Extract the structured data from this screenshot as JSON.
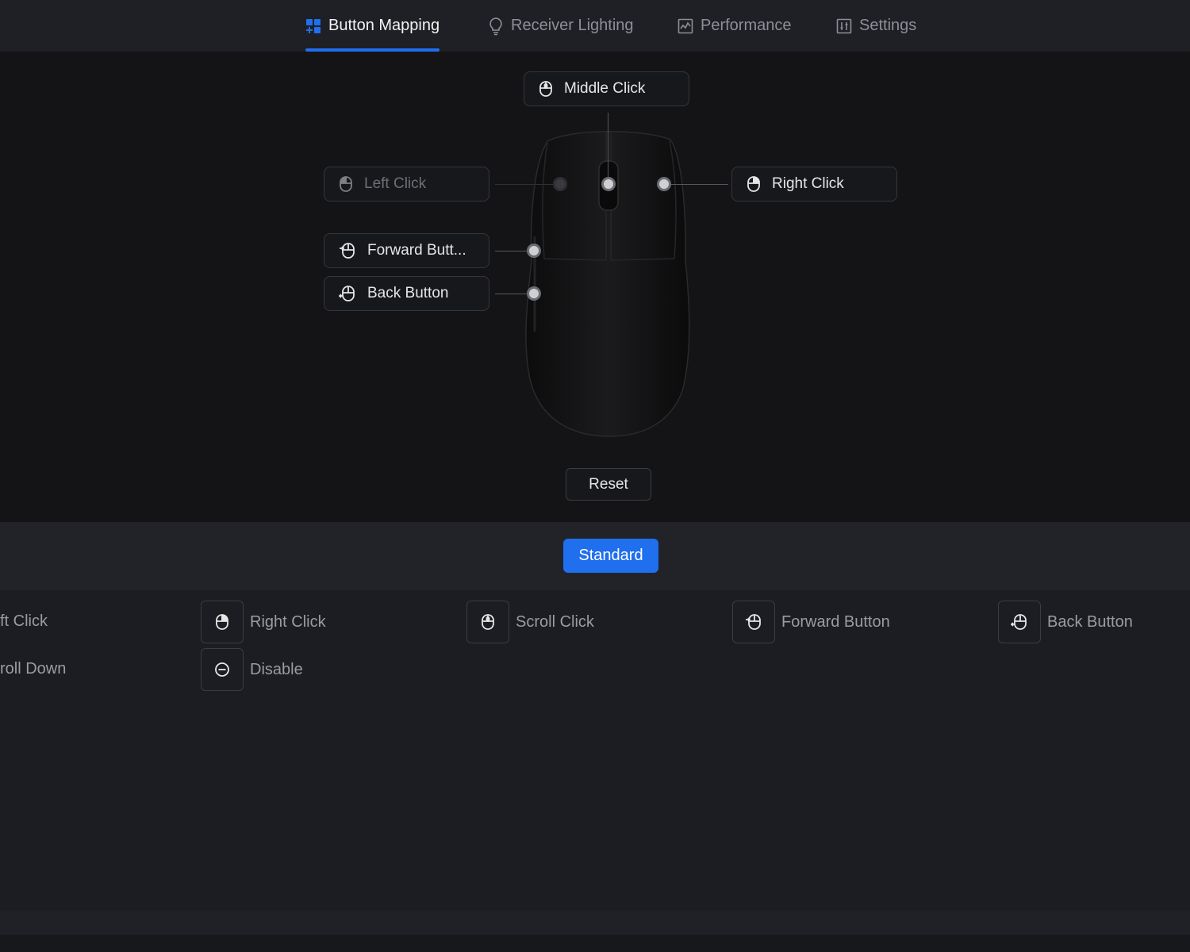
{
  "nav": {
    "tabs": [
      {
        "label": "Button Mapping",
        "icon": "grid-icon",
        "active": true
      },
      {
        "label": "Receiver Lighting",
        "icon": "lightbulb-icon",
        "active": false
      },
      {
        "label": "Performance",
        "icon": "chart-icon",
        "active": false
      },
      {
        "label": "Settings",
        "icon": "sliders-icon",
        "active": false
      }
    ],
    "accent": "#1f6fee"
  },
  "mapping": {
    "middle": "Middle Click",
    "left": "Left Click",
    "right": "Right Click",
    "forward": "Forward Butt...",
    "back": "Back Button",
    "reset": "Reset"
  },
  "mode": {
    "selected": "Standard"
  },
  "actions": {
    "row1": [
      {
        "label": "ft Click"
      },
      {
        "label": "Right Click",
        "icon": "mouse-right-icon"
      },
      {
        "label": "Scroll Click",
        "icon": "mouse-scroll-icon"
      },
      {
        "label": "Forward Button",
        "icon": "mouse-forward-icon"
      },
      {
        "label": "Back Button",
        "icon": "mouse-back-icon"
      }
    ],
    "row2": [
      {
        "label": "roll Down"
      },
      {
        "label": "Disable",
        "icon": "disable-icon"
      }
    ]
  }
}
